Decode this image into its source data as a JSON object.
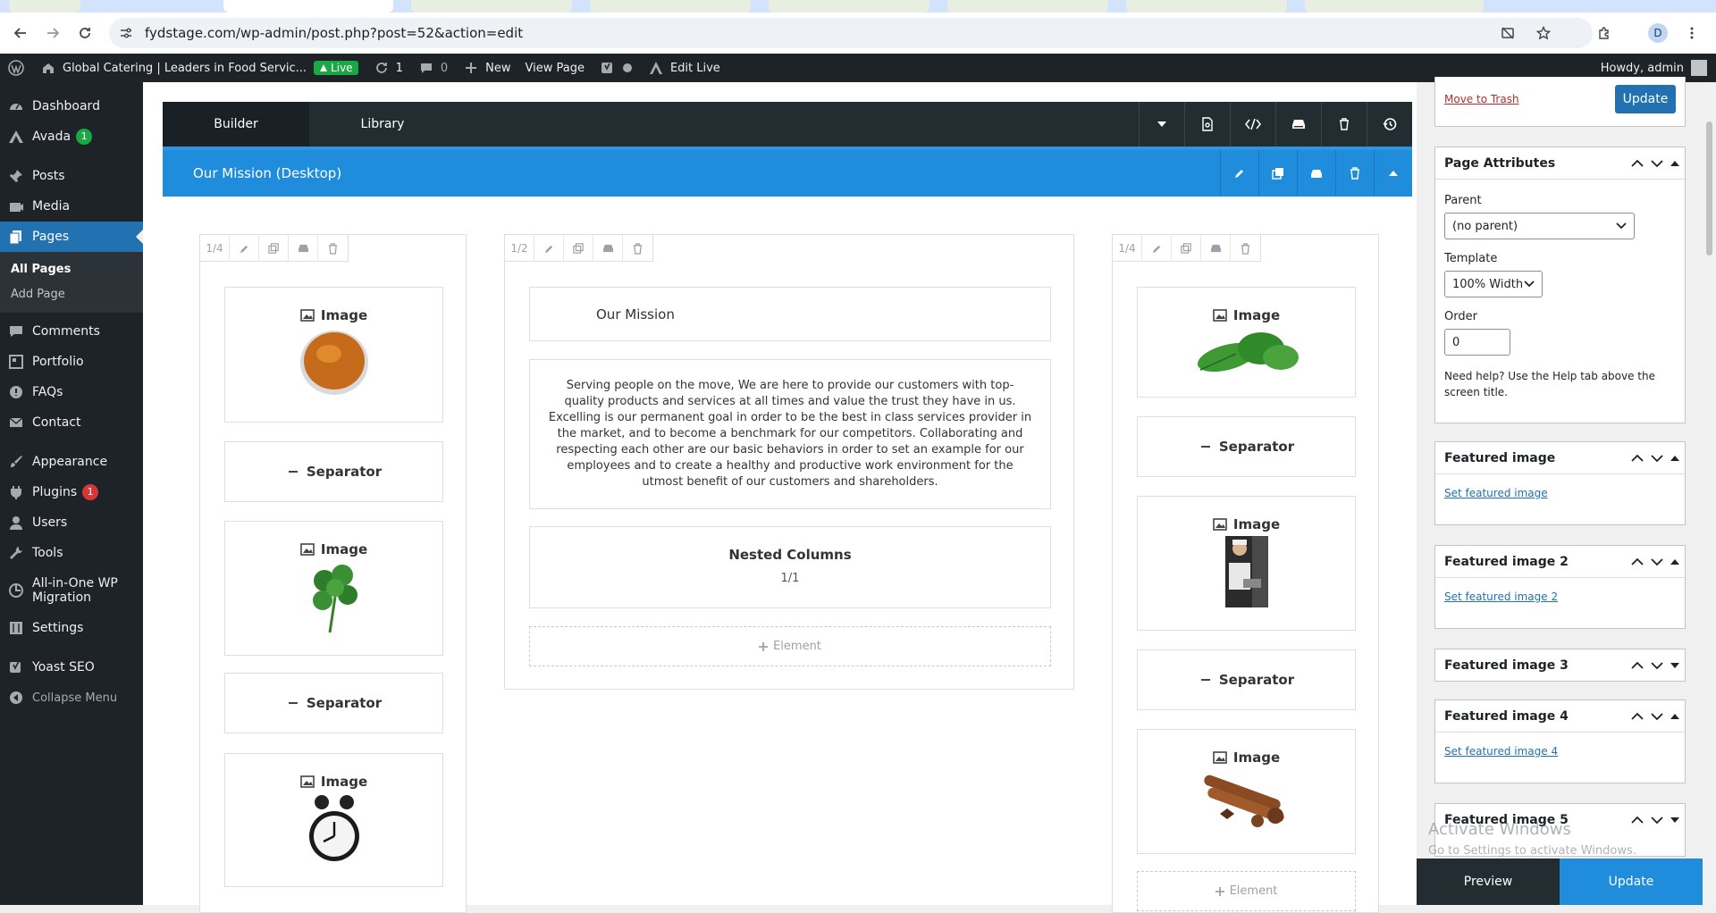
{
  "browser": {
    "url": "fydstage.com/wp-admin/post.php?post=52&action=edit",
    "profile_initial": "D"
  },
  "adminbar": {
    "site_title": "Global Catering | Leaders in Food Servic...",
    "live_label": "Live",
    "updates_count": "1",
    "comments_count": "0",
    "new_label": "New",
    "view_page_label": "View Page",
    "edit_live_label": "Edit Live",
    "howdy": "Howdy, admin"
  },
  "sidebar": {
    "dashboard": "Dashboard",
    "avada": "Avada",
    "avada_badge": "1",
    "posts": "Posts",
    "media": "Media",
    "pages": "Pages",
    "all_pages": "All Pages",
    "add_page": "Add Page",
    "comments": "Comments",
    "portfolio": "Portfolio",
    "faqs": "FAQs",
    "contact": "Contact",
    "appearance": "Appearance",
    "plugins": "Plugins",
    "plugins_badge": "1",
    "users": "Users",
    "tools": "Tools",
    "migration": "All-in-One WP Migration",
    "settings": "Settings",
    "yoast": "Yoast SEO",
    "collapse": "Collapse Menu"
  },
  "builder": {
    "tab_builder": "Builder",
    "tab_library": "Library",
    "container_title": "Our Mission (Desktop)",
    "col_left_size": "1/4",
    "col_mid_size": "1/2",
    "col_right_size": "1/4",
    "image_label": "Image",
    "separator_label": "Separator",
    "element_label": "Element",
    "mission_title": "Our Mission",
    "mission_text": "Serving people on the move, We are here to provide our customers with top-quality products and services at all times and value the trust they have in us. Excelling is our permanent goal in order to be the best in class services provider in the market, and to become a benchmark for our competitors. Collaborating and respecting each other are our basic behaviors in order to set an example for our employees and to create a healthy and productive work environment for the utmost benefit of our customers and shareholders.",
    "nested_title": "Nested Columns",
    "nested_sub": "1/1"
  },
  "panel": {
    "move_to_trash": "Move to Trash",
    "update": "Update",
    "page_attributes": "Page Attributes",
    "parent_label": "Parent",
    "parent_value": "(no parent)",
    "template_label": "Template",
    "template_value": "100% Width",
    "order_label": "Order",
    "order_value": "0",
    "help_text": "Need help? Use the Help tab above the screen title.",
    "featured_1": "Featured image",
    "featured_1_link": "Set featured image",
    "featured_2": "Featured image 2",
    "featured_2_link": "Set featured image 2",
    "featured_3": "Featured image 3",
    "featured_4": "Featured image 4",
    "featured_4_link": "Set featured image 4",
    "featured_5": "Featured image 5",
    "preview": "Preview",
    "update_bottom": "Update"
  },
  "watermark": {
    "line1": "Activate Windows",
    "line2": "Go to Settings to activate Windows."
  },
  "colors": {
    "wp_dark": "#1d2327",
    "wp_blue": "#2271b1",
    "builder_blue": "#1f8ddc",
    "live_green": "#1aa845"
  }
}
